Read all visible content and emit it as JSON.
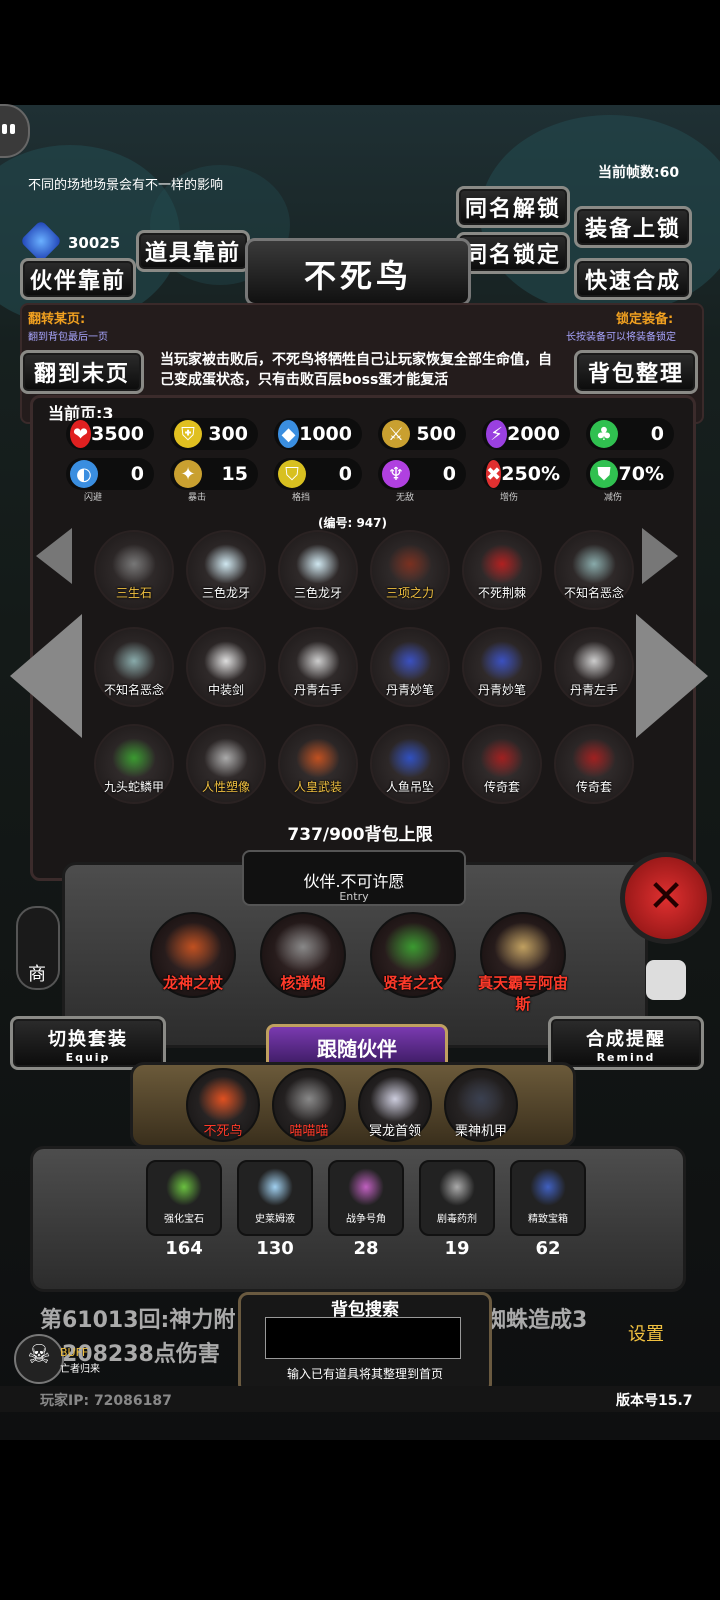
{
  "status": {
    "fps": "当前帧数:60",
    "tip": "不同的场地场景会有不一样的影响",
    "currency": "30025"
  },
  "buttons": {
    "same_unlock": "同名解锁",
    "equip_lock": "装备上锁",
    "items_front": "道具靠前",
    "same_lock": "同名锁定",
    "partner_front": "伙伴靠前",
    "quick_merge": "快速合成",
    "last_page": "翻到末页",
    "sort_bag": "背包整理"
  },
  "title": "不死鸟",
  "flip": {
    "label": "翻转某页:",
    "hint": "翻到背包最后一页"
  },
  "lock": {
    "label": "锁定装备:",
    "hint": "长按装备可以将装备锁定"
  },
  "description": "当玩家被击败后，不死鸟将牺牲自己让玩家恢复全部生命值，自己变成蛋状态，只有击败百层boss蛋才能复活",
  "current_page": "当前页:3",
  "stats_row1": [
    {
      "icon": "heart-icon",
      "value": "3500",
      "color": "#e02020"
    },
    {
      "icon": "armor-icon",
      "value": "300",
      "color": "#e0c020"
    },
    {
      "icon": "boot-icon",
      "value": "1000",
      "color": "#3a8ee0"
    },
    {
      "icon": "sword-icon",
      "value": "500",
      "color": "#c9a030"
    },
    {
      "icon": "lightning-icon",
      "value": "2000",
      "color": "#9a40e0"
    },
    {
      "icon": "clover-icon",
      "value": "0",
      "color": "#30c050"
    }
  ],
  "stats_row2": [
    {
      "icon": "dodge-icon",
      "value": "0",
      "label": "闪避",
      "color": "#3a8ee0"
    },
    {
      "icon": "crit-icon",
      "value": "15",
      "label": "暴击",
      "color": "#c9a030"
    },
    {
      "icon": "block-icon",
      "value": "0",
      "label": "格挡",
      "color": "#d8c020"
    },
    {
      "icon": "invincible-icon",
      "value": "0",
      "label": "无敌",
      "color": "#b040e0"
    },
    {
      "icon": "damage-up-icon",
      "value": "250%",
      "label": "增伤",
      "color": "#e03030"
    },
    {
      "icon": "damage-down-icon",
      "value": "70%",
      "label": "减伤",
      "color": "#30c050"
    }
  ],
  "serial": "(编号: 947)",
  "grid": [
    {
      "name": "三生石",
      "color": "#f0c040",
      "tint": "#777"
    },
    {
      "name": "三色龙牙",
      "color": "#ffffff",
      "tint": "#cfe7f0"
    },
    {
      "name": "三色龙牙",
      "color": "#ffffff",
      "tint": "#cfe7f0"
    },
    {
      "name": "三项之力",
      "color": "#f0c040",
      "tint": "#7a3020"
    },
    {
      "name": "不死荆棘",
      "color": "#ffffff",
      "tint": "#b02020"
    },
    {
      "name": "不知名恶念",
      "color": "#ffffff",
      "tint": "#8aa"
    },
    {
      "name": "不知名恶念",
      "color": "#ffffff",
      "tint": "#8aa"
    },
    {
      "name": "中装剑",
      "color": "#ffffff",
      "tint": "#ddd"
    },
    {
      "name": "丹青右手",
      "color": "#ffffff",
      "tint": "#ccc"
    },
    {
      "name": "丹青妙笔",
      "color": "#ffffff",
      "tint": "#3a50c0"
    },
    {
      "name": "丹青妙笔",
      "color": "#ffffff",
      "tint": "#3a50c0"
    },
    {
      "name": "丹青左手",
      "color": "#ffffff",
      "tint": "#ccc"
    },
    {
      "name": "九头蛇鳞甲",
      "color": "#ffffff",
      "tint": "#3a9a30"
    },
    {
      "name": "人性塑像",
      "color": "#f0c040",
      "tint": "#aaa"
    },
    {
      "name": "人皇武装",
      "color": "#f0c040",
      "tint": "#c05020"
    },
    {
      "name": "人鱼吊坠",
      "color": "#ffffff",
      "tint": "#3050c0"
    },
    {
      "name": "传奇套",
      "color": "#ffffff",
      "tint": "#a02020"
    },
    {
      "name": "传奇套",
      "color": "#ffffff",
      "tint": "#a02020"
    }
  ],
  "bag_limit": "737/900背包上限",
  "entry": {
    "title": "伙伴.不可许愿",
    "sub": "Entry"
  },
  "orbs": [
    {
      "name": "龙神之杖",
      "tint": "#c05020"
    },
    {
      "name": "核弹炮",
      "tint": "#888"
    },
    {
      "name": "贤者之衣",
      "tint": "#3a9a30"
    },
    {
      "name": "真天霸号阿宙斯",
      "tint": "#c0a060"
    }
  ],
  "shop_label": "商",
  "switch_equip": {
    "title": "切换套装",
    "sub": "Equip"
  },
  "follow_partner": "跟随伙伴",
  "merge_remind": {
    "title": "合成提醒",
    "sub": "Remind"
  },
  "companions": [
    {
      "name": "不死鸟",
      "tint": "#e05020",
      "color": "#ff3a2a"
    },
    {
      "name": "喵喵喵",
      "tint": "#888",
      "color": "#ff3a2a"
    },
    {
      "name": "冥龙首领",
      "tint": "#ccd",
      "color": "#ffffff"
    },
    {
      "name": "栗神机甲",
      "tint": "#3a4050",
      "color": "#ffffff"
    }
  ],
  "inventory": [
    {
      "name": "强化宝石",
      "count": "164",
      "tint": "#6ac040"
    },
    {
      "name": "史莱姆液",
      "count": "130",
      "tint": "#a0d0f0"
    },
    {
      "name": "战争号角",
      "count": "28",
      "tint": "#c060c0"
    },
    {
      "name": "剧毒药剂",
      "count": "19",
      "tint": "#aaa"
    },
    {
      "name": "精致宝箱",
      "count": "62",
      "tint": "#4060c0"
    }
  ],
  "log": {
    "line1": "第61013回:神力附",
    "line1b": "蜘蛛造成3",
    "line2": "208238点伤害"
  },
  "search": {
    "title": "背包搜索",
    "hint": "输入已有道具将其整理到首页",
    "placeholder": ""
  },
  "settings": "设置",
  "buff": {
    "label": "BUFF",
    "sub": "亡者归来"
  },
  "player_ip": "玩家IP:  72086187",
  "version": "版本号15.7"
}
